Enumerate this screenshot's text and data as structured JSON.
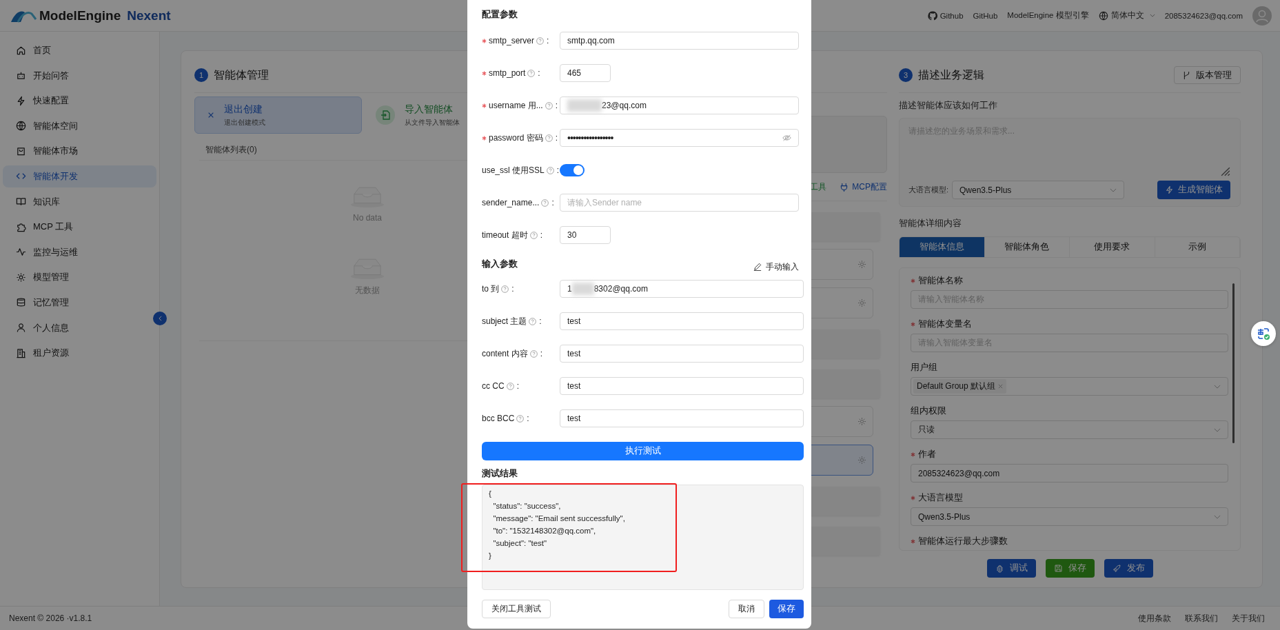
{
  "header": {
    "brand": "ModelEngine",
    "brand_accent": "Nexent",
    "github_label": "Github",
    "github_label_2": "GitHub",
    "engine_link": "ModelEngine 模型引擎",
    "language": "简体中文",
    "user_email": "2085324623@qq.com"
  },
  "sidebar": {
    "items": [
      {
        "label": "首页",
        "selected": false
      },
      {
        "label": "开始问答",
        "selected": false
      },
      {
        "label": "快速配置",
        "selected": false
      },
      {
        "label": "智能体空间",
        "selected": false
      },
      {
        "label": "智能体市场",
        "selected": false
      },
      {
        "label": "智能体开发",
        "selected": true
      },
      {
        "label": "知识库",
        "selected": false
      },
      {
        "label": "MCP 工具",
        "selected": false
      },
      {
        "label": "监控与运维",
        "selected": false
      },
      {
        "label": "模型管理",
        "selected": false
      },
      {
        "label": "记忆管理",
        "selected": false
      },
      {
        "label": "个人信息",
        "selected": false
      },
      {
        "label": "租户资源",
        "selected": false
      }
    ]
  },
  "agent_management": {
    "step": "1",
    "title": "智能体管理",
    "actions": [
      {
        "kind": "exit",
        "title": "退出创建",
        "subtitle": "退出创建模式",
        "selected": true
      },
      {
        "kind": "import",
        "title": "导入智能体",
        "subtitle": "从文件导入智能体",
        "selected": false
      }
    ],
    "list_title": "智能体列表(0)",
    "empty_states": [
      "No data",
      "无数据"
    ]
  },
  "tools": {
    "tools_link": "工具",
    "mcp_link": "MCP配置",
    "items": [
      {
        "kind": "skeleton"
      },
      {
        "kind": "card",
        "selected": false
      },
      {
        "kind": "card",
        "selected": false
      },
      {
        "kind": "skeleton"
      },
      {
        "kind": "skeleton"
      },
      {
        "kind": "card",
        "selected": false
      },
      {
        "kind": "card",
        "selected": true
      },
      {
        "kind": "skeleton"
      },
      {
        "kind": "skeleton"
      }
    ]
  },
  "business_logic": {
    "step": "3",
    "title": "描述业务逻辑",
    "version_button": "版本管理",
    "prompt_label": "描述智能体应该如何工作",
    "prompt_placeholder": "请描述您的业务场景和需求...",
    "model_label": "大语言模型:",
    "model_value": "Qwen3.5-Plus",
    "generate_button": "生成智能体",
    "details_title": "智能体详细内容",
    "tabs": [
      {
        "label": "智能体信息",
        "selected": true
      },
      {
        "label": "智能体角色",
        "selected": false
      },
      {
        "label": "使用要求",
        "selected": false
      },
      {
        "label": "示例",
        "selected": false
      }
    ],
    "fields": [
      {
        "kind": "input",
        "label": "智能体名称",
        "required": true,
        "placeholder": "请输入智能体名称"
      },
      {
        "kind": "input",
        "label": "智能体变量名",
        "required": true,
        "placeholder": "请输入智能体变量名"
      },
      {
        "kind": "tags",
        "label": "用户组",
        "required": false,
        "tags": [
          "Default Group 默认组"
        ]
      },
      {
        "kind": "select",
        "label": "组内权限",
        "required": false,
        "value": "只读"
      },
      {
        "kind": "input",
        "label": "作者",
        "required": true,
        "value": "2085324623@qq.com"
      },
      {
        "kind": "select",
        "label": "大语言模型",
        "required": true,
        "value": "Qwen3.5-Plus"
      },
      {
        "kind": "heading",
        "label": "智能体运行最大步骤数",
        "required": true
      }
    ],
    "actions": [
      {
        "kind": "debug",
        "label": "调试"
      },
      {
        "kind": "save",
        "label": "保存"
      },
      {
        "kind": "publish",
        "label": "发布"
      }
    ]
  },
  "dialog": {
    "config_title": "配置参数",
    "config_params": [
      {
        "kind": "text",
        "label": "smtp_server",
        "required": true,
        "colon": ":",
        "value": "smtp.qq.com"
      },
      {
        "kind": "number",
        "label": "smtp_port",
        "required": true,
        "colon": ":",
        "value": "465"
      },
      {
        "kind": "text",
        "label": "username 用...",
        "required": true,
        "colon": ":",
        "value": "23@qq.com",
        "redacted": true
      },
      {
        "kind": "password",
        "label": "password 密码",
        "required": true,
        "colon": ":",
        "value": "•••••••••••••••••"
      },
      {
        "kind": "switch",
        "label": "use_ssl 使用SSL",
        "required": false,
        "colon": ":",
        "on": true
      },
      {
        "kind": "text",
        "label": "sender_name...",
        "required": false,
        "colon": ":",
        "placeholder": "请输入Sender name"
      },
      {
        "kind": "number",
        "label": "timeout 超时",
        "required": false,
        "colon": ":",
        "value": "30"
      }
    ],
    "input_title": "输入参数",
    "manual_input": "手动输入",
    "input_params": [
      {
        "kind": "text",
        "label": "to 到",
        "required": false,
        "colon": ":",
        "value_prefix": "1",
        "value": "8302@qq.com",
        "redacted": true
      },
      {
        "kind": "text",
        "label": "subject 主题",
        "required": false,
        "colon": ":",
        "value": "test"
      },
      {
        "kind": "text",
        "label": "content 内容",
        "required": false,
        "colon": ":",
        "value": "test"
      },
      {
        "kind": "text",
        "label": "cc CC",
        "required": false,
        "colon": ":",
        "value": "test"
      },
      {
        "kind": "text",
        "label": "bcc BCC",
        "required": false,
        "colon": ":",
        "value": "test"
      }
    ],
    "run_button": "执行测试",
    "result_title": "测试结果",
    "result_text": "{\n  \"status\": \"success\",\n  \"message\": \"Email sent successfully\",\n  \"to\": \"1532148302@qq.com\",\n  \"subject\": \"test\"\n}",
    "result_highlighted": true,
    "close_test_button": "关闭工具测试",
    "cancel_button": "取消",
    "save_button": "保存"
  },
  "footer": {
    "copyright": "Nexent © 2026 ·v1.8.1",
    "links": [
      "使用条款",
      "联系我们",
      "关于我们"
    ]
  }
}
